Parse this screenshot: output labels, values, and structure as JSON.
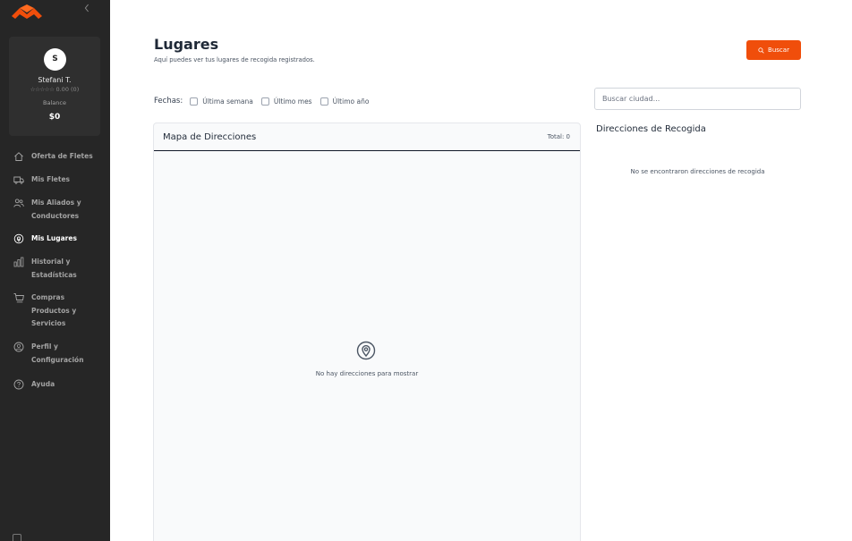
{
  "sidebar": {
    "profile": {
      "initial": "S",
      "name": "Stefani T.",
      "stars": "☆☆☆☆☆",
      "rating": "0.00 (0)",
      "balance_label": "Balance",
      "balance_value": "$0"
    },
    "items": [
      {
        "label_lines": [
          "Oferta de Fletes"
        ],
        "icon": "home-icon"
      },
      {
        "label_lines": [
          "Mis Fletes"
        ],
        "icon": "truck-icon"
      },
      {
        "label_lines": [
          "Mis Aliados y",
          "Conductores"
        ],
        "icon": "users-icon"
      },
      {
        "label_lines": [
          "Mis Lugares"
        ],
        "icon": "location-pin-icon",
        "active": true
      },
      {
        "label_lines": [
          "Historial y",
          "Estadísticas"
        ],
        "icon": "bar-chart-icon"
      },
      {
        "label_lines": [
          "Compras",
          "Productos y",
          "Servicios"
        ],
        "icon": "cart-icon"
      },
      {
        "label_lines": [
          "Perfil y",
          "Configuración"
        ],
        "icon": "user-circle-icon"
      },
      {
        "label_lines": [
          "Ayuda"
        ],
        "icon": "help-icon"
      }
    ]
  },
  "header": {
    "title": "Lugares",
    "subtitle": "Aquí puedes ver tus lugares de recogida registrados.",
    "search_button": "Buscar"
  },
  "filters": {
    "label": "Fechas:",
    "options": [
      "Última semana",
      "Último mes",
      "Último año"
    ]
  },
  "map": {
    "title": "Mapa de Direcciones",
    "total": "Total: 0",
    "empty_text": "No hay direcciones para mostrar"
  },
  "directions": {
    "search_placeholder": "Buscar ciudad...",
    "title": "Direcciones de Recogida",
    "empty_text": "No se encontraron direcciones de recogida"
  },
  "colors": {
    "accent": "#f04e0b",
    "sidebar_bg": "#262626"
  }
}
